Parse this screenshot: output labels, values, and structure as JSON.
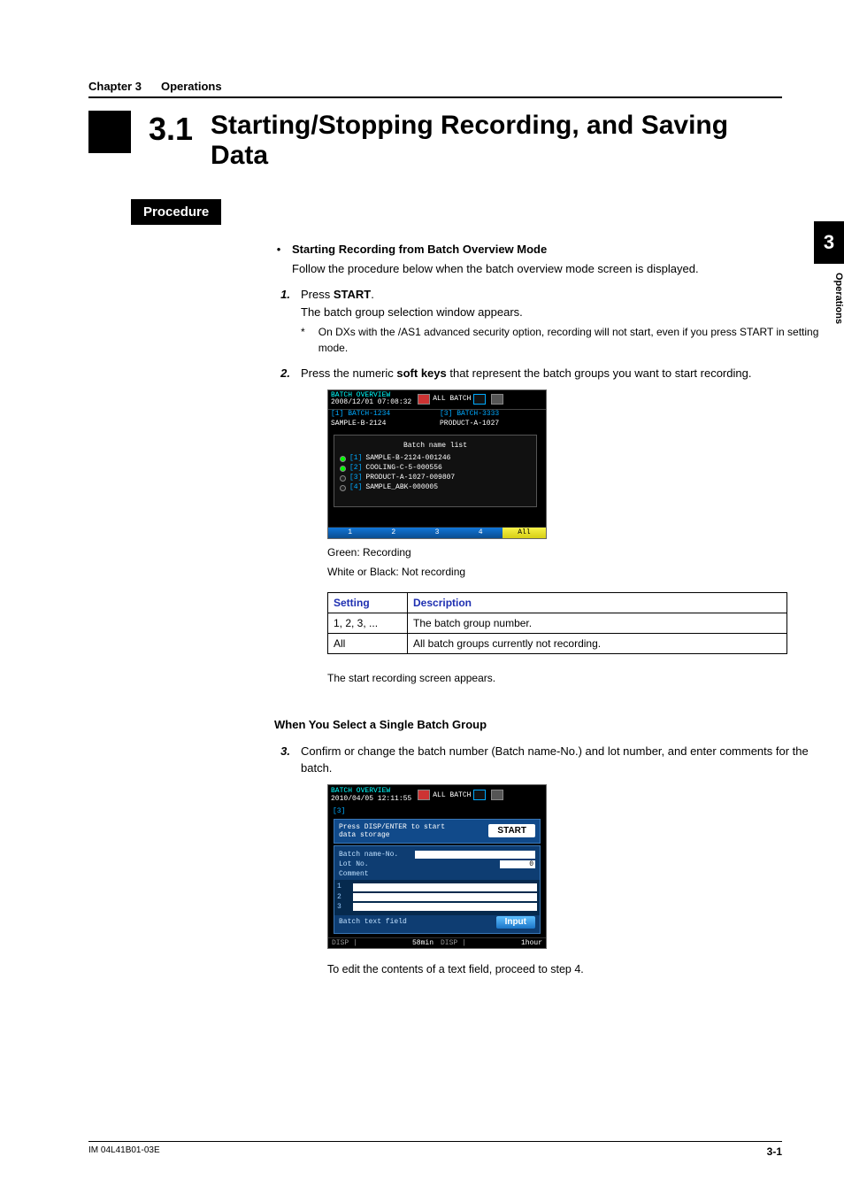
{
  "chapter": {
    "label": "Chapter 3",
    "name": "Operations"
  },
  "section": {
    "number": "3.1",
    "title": "Starting/Stopping Recording, and Saving Data"
  },
  "procedure_label": "Procedure",
  "bullet": {
    "heading": "Starting Recording from Batch Overview Mode",
    "intro": "Follow the procedure below when the batch overview mode screen is displayed."
  },
  "step1": {
    "no": "1.",
    "line_a": "Press ",
    "line_a_strong": "START",
    "line_a_end": ".",
    "line_b": "The batch group selection window appears.",
    "note": "On DXs with the /AS1 advanced security option, recording will not start, even if you press START in setting mode.",
    "star": "*"
  },
  "step2": {
    "no": "2.",
    "line_a": "Press the numeric ",
    "line_strong": "soft keys",
    "line_b": " that represent the batch groups you want to start recording."
  },
  "device1": {
    "header_title": "BATCH OVERVIEW",
    "header_date": "2008/12/01 07:08:32",
    "header_mode": "ALL BATCH",
    "col_l_top": "[1] BATCH-1234",
    "col_r_top": "[3] BATCH-3333",
    "col_l_bot": "SAMPLE-B-2124",
    "col_r_bot": "PRODUCT-A-1027",
    "list_title": "Batch name list",
    "rows": [
      {
        "idx": "[1]",
        "name": "SAMPLE-B-2124-001246",
        "green": true
      },
      {
        "idx": "[2]",
        "name": "COOLING-C-5-000556",
        "green": true
      },
      {
        "idx": "[3]",
        "name": "PRODUCT-A-1027-009807",
        "green": false
      },
      {
        "idx": "[4]",
        "name": "SAMPLE_ABK-000005",
        "green": false
      }
    ],
    "softkeys": [
      "1",
      "2",
      "3",
      "4",
      "All"
    ]
  },
  "legend": {
    "g": "Green: Recording",
    "w": "White or Black: Not recording"
  },
  "table": {
    "hdr_setting": "Setting",
    "hdr_desc": "Description",
    "r1c1": "1, 2, 3, ...",
    "r1c2": "The batch group number.",
    "r2c1": "All",
    "r2c2": "All batch groups currently not recording."
  },
  "after_table": "The start recording screen appears.",
  "heading2": "When You Select a Single Batch Group",
  "step3": {
    "no": "3.",
    "text": "Confirm or change the batch number (Batch name-No.) and lot number, and enter comments for the batch."
  },
  "device2": {
    "header_title": "BATCH OVERVIEW",
    "header_date": "2010/04/05 12:11:55",
    "header_mode": "ALL BATCH",
    "tab": "[3]",
    "prompt_a": "Press DISP/ENTER to start",
    "prompt_b": "data storage",
    "btn_start": "START",
    "lbl_name": "Batch name-No.",
    "lbl_lot": "Lot No.",
    "val_lot": "0",
    "lbl_comment": "Comment",
    "c1": "1",
    "c2": "2",
    "c3": "3",
    "lbl_text": "Batch text field",
    "btn_input": "Input",
    "bl1a": "DISP |",
    "bl1b": "58min",
    "bl2a": "DISP |",
    "bl2b": "1hour"
  },
  "after_dev2": "To edit the contents of a text field, proceed to step 4.",
  "sidetab": {
    "num": "3",
    "label": "Operations"
  },
  "footer": {
    "code": "IM 04L41B01-03E",
    "page": "3-1"
  }
}
